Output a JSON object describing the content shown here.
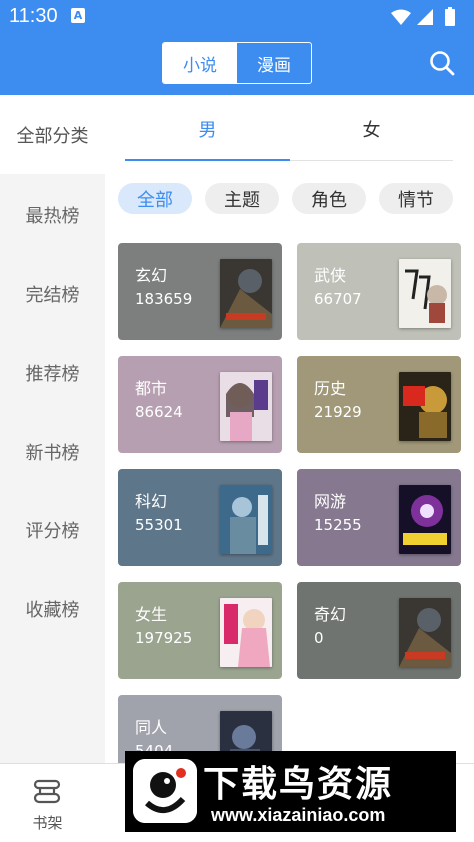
{
  "status_bar": {
    "time": "11:30",
    "a_badge": "A"
  },
  "header": {
    "tabs": [
      {
        "label": "小说",
        "active": true
      },
      {
        "label": "漫画",
        "active": false
      }
    ],
    "search_icon": "search-icon",
    "accent_color": "#3d8cf0"
  },
  "sidebar": {
    "items": [
      "全部分类",
      "最热榜",
      "完结榜",
      "推荐榜",
      "新书榜",
      "评分榜",
      "收藏榜"
    ]
  },
  "gender_tabs": [
    {
      "label": "男",
      "active": true
    },
    {
      "label": "女",
      "active": false
    }
  ],
  "filters": [
    {
      "label": "全部",
      "active": true
    },
    {
      "label": "主题",
      "active": false
    },
    {
      "label": "角色",
      "active": false
    },
    {
      "label": "情节",
      "active": false
    }
  ],
  "categories": [
    {
      "name": "玄幻",
      "count": "183659",
      "color": "#7c7f7e"
    },
    {
      "name": "武侠",
      "count": "66707",
      "color": "#bfc0b7"
    },
    {
      "name": "都市",
      "count": "86624",
      "color": "#b69fb1"
    },
    {
      "name": "历史",
      "count": "21929",
      "color": "#a09878"
    },
    {
      "name": "科幻",
      "count": "55301",
      "color": "#5e7689"
    },
    {
      "name": "网游",
      "count": "15255",
      "color": "#85788f"
    },
    {
      "name": "女生",
      "count": "197925",
      "color": "#9aa48f"
    },
    {
      "name": "奇幻",
      "count": "0",
      "color": "#6f7471"
    },
    {
      "name": "同人",
      "count": "5404",
      "color": "#a0a2ac"
    }
  ],
  "bottom_nav": {
    "shelf_label": "书架"
  },
  "watermark": {
    "title": "下载鸟资源",
    "url": "www.xiazainiao.com"
  }
}
